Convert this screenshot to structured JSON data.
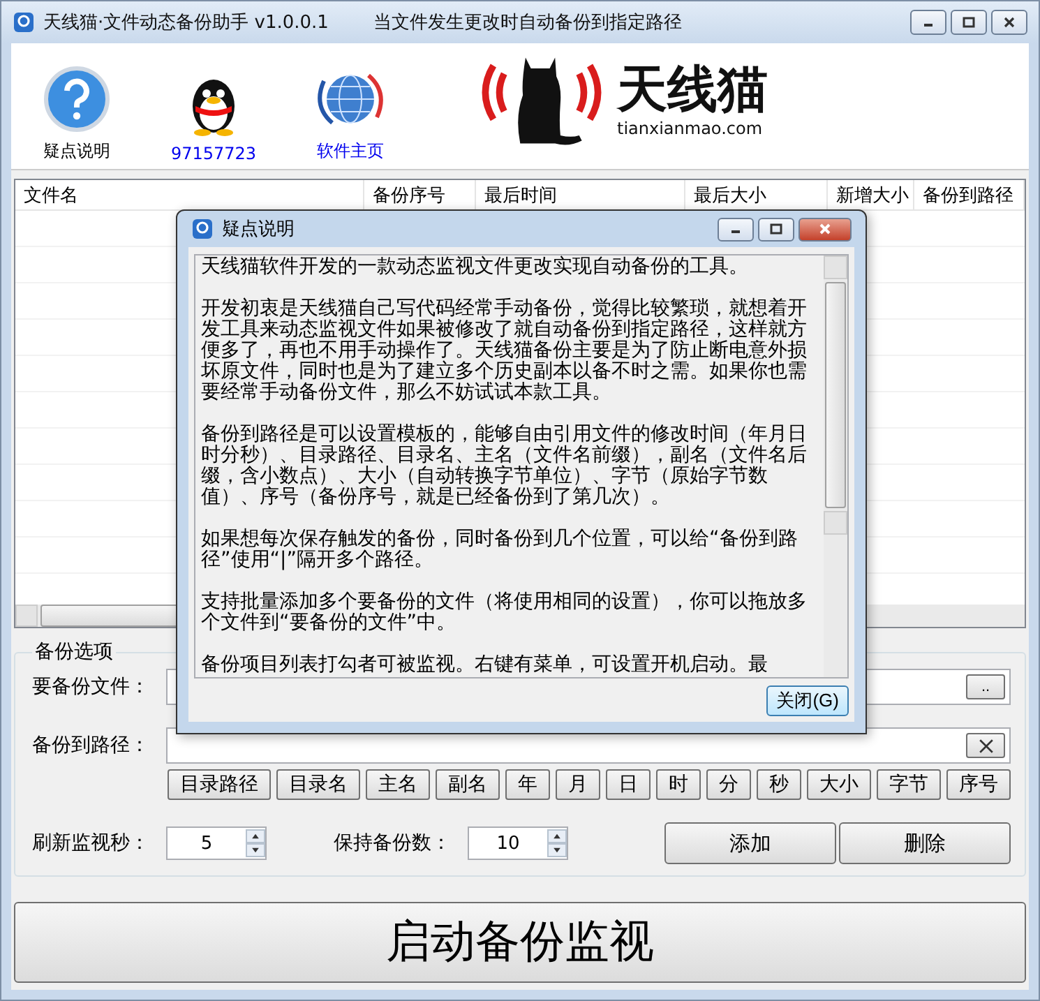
{
  "window": {
    "title": "天线猫·文件动态备份助手 v1.0.0.1",
    "subtitle": "当文件发生更改时自动备份到指定路径"
  },
  "toolbar": [
    {
      "label": "疑点说明",
      "kind": "help",
      "link": false
    },
    {
      "label": "97157723",
      "kind": "qq",
      "link": true
    },
    {
      "label": "软件主页",
      "kind": "globe",
      "link": true
    }
  ],
  "logo": {
    "name": "天线猫",
    "domain": "tianxianmao.com"
  },
  "table": {
    "columns": [
      "文件名",
      "备份序号",
      "最后时间",
      "最后大小",
      "新增大小",
      "备份到路径"
    ]
  },
  "options": {
    "title": "备份选项",
    "file_label": "要备份文件：",
    "browse": "..",
    "path_label": "备份到路径：",
    "tokens": [
      "目录路径",
      "目录名",
      "主名",
      "副名",
      "年",
      "月",
      "日",
      "时",
      "分",
      "秒",
      "大小",
      "字节",
      "序号"
    ],
    "refresh_label": "刷新监视秒：",
    "refresh_value": "5",
    "keep_label": "保持备份数：",
    "keep_value": "10",
    "add": "添加",
    "delete": "删除"
  },
  "start_button": "启动备份监视",
  "dialog": {
    "title": "疑点说明",
    "paragraphs": [
      "天线猫软件开发的一款动态监视文件更改实现自动备份的工具。",
      "开发初衷是天线猫自己写代码经常手动备份，觉得比较繁琐，就想着开发工具来动态监视文件如果被修改了就自动备份到指定路径，这样就方便多了，再也不用手动操作了。天线猫备份主要是为了防止断电意外损坏原文件，同时也是为了建立多个历史副本以备不时之需。如果你也需要经常手动备份文件，那么不妨试试本款工具。",
      "备份到路径是可以设置模板的，能够自由引用文件的修改时间（年月日时分秒）、目录路径、目录名、主名（文件名前缀），副名（文件名后缀，含小数点）、大小（自动转换字节单位）、字节（原始字节数值）、序号（备份序号，就是已经备份到了第几次）。",
      "如果想每次保存触发的备份，同时备份到几个位置，可以给“备份到路径”使用“|”隔开多个路径。",
      "支持批量添加多个要备份的文件（将使用相同的设置），你可以拖放多个文件到“要备份的文件”中。",
      "备份项目列表打勾者可被监视。右键有菜单，可设置开机启动。最"
    ],
    "close": "关闭(G)"
  }
}
